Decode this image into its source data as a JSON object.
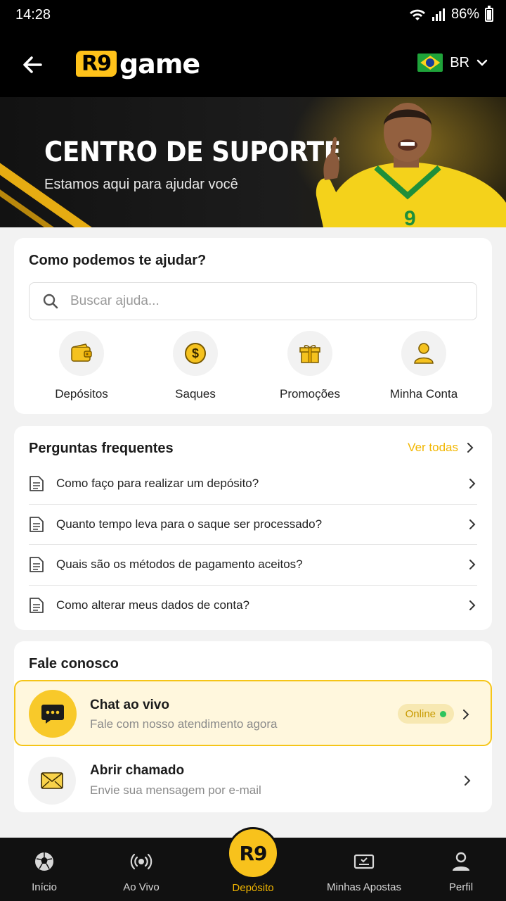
{
  "status_bar": {
    "time": "14:28",
    "battery": "86%"
  },
  "header": {
    "logo_mark": "R9",
    "logo_text": "game",
    "language": "BR"
  },
  "hero": {
    "title": "CENTRO DE SUPORTE",
    "subtitle": "Estamos aqui para ajudar você",
    "jersey_number": "9"
  },
  "help": {
    "title": "Como podemos te ajudar?",
    "search_placeholder": "Buscar ajuda...",
    "categories": [
      {
        "label": "Depósitos",
        "icon": "wallet-icon"
      },
      {
        "label": "Saques",
        "icon": "dollar-coin-icon"
      },
      {
        "label": "Promoções",
        "icon": "gift-icon"
      },
      {
        "label": "Minha Conta",
        "icon": "user-icon"
      }
    ]
  },
  "faq": {
    "title": "Perguntas frequentes",
    "see_all": "Ver todas",
    "items": [
      "Como faço para realizar um depósito?",
      "Quanto tempo leva para o saque ser processado?",
      "Quais são os métodos de pagamento aceitos?",
      "Como alterar meus dados de conta?"
    ]
  },
  "contact": {
    "title": "Fale conosco",
    "live_chat": {
      "title": "Chat ao vivo",
      "subtitle": "Fale com nosso atendimento agora",
      "badge": "Online"
    },
    "ticket": {
      "title": "Abrir chamado",
      "subtitle": "Envie sua mensagem por e-mail"
    }
  },
  "nav": {
    "items": [
      "Início",
      "Ao Vivo",
      "Depósito",
      "Minhas Apostas",
      "Perfil"
    ],
    "center_mark": "R9"
  },
  "colors": {
    "accent": "#f8c21c",
    "background": "#f2f2f2",
    "dark": "#111111",
    "online_dot": "#2ec45c"
  }
}
